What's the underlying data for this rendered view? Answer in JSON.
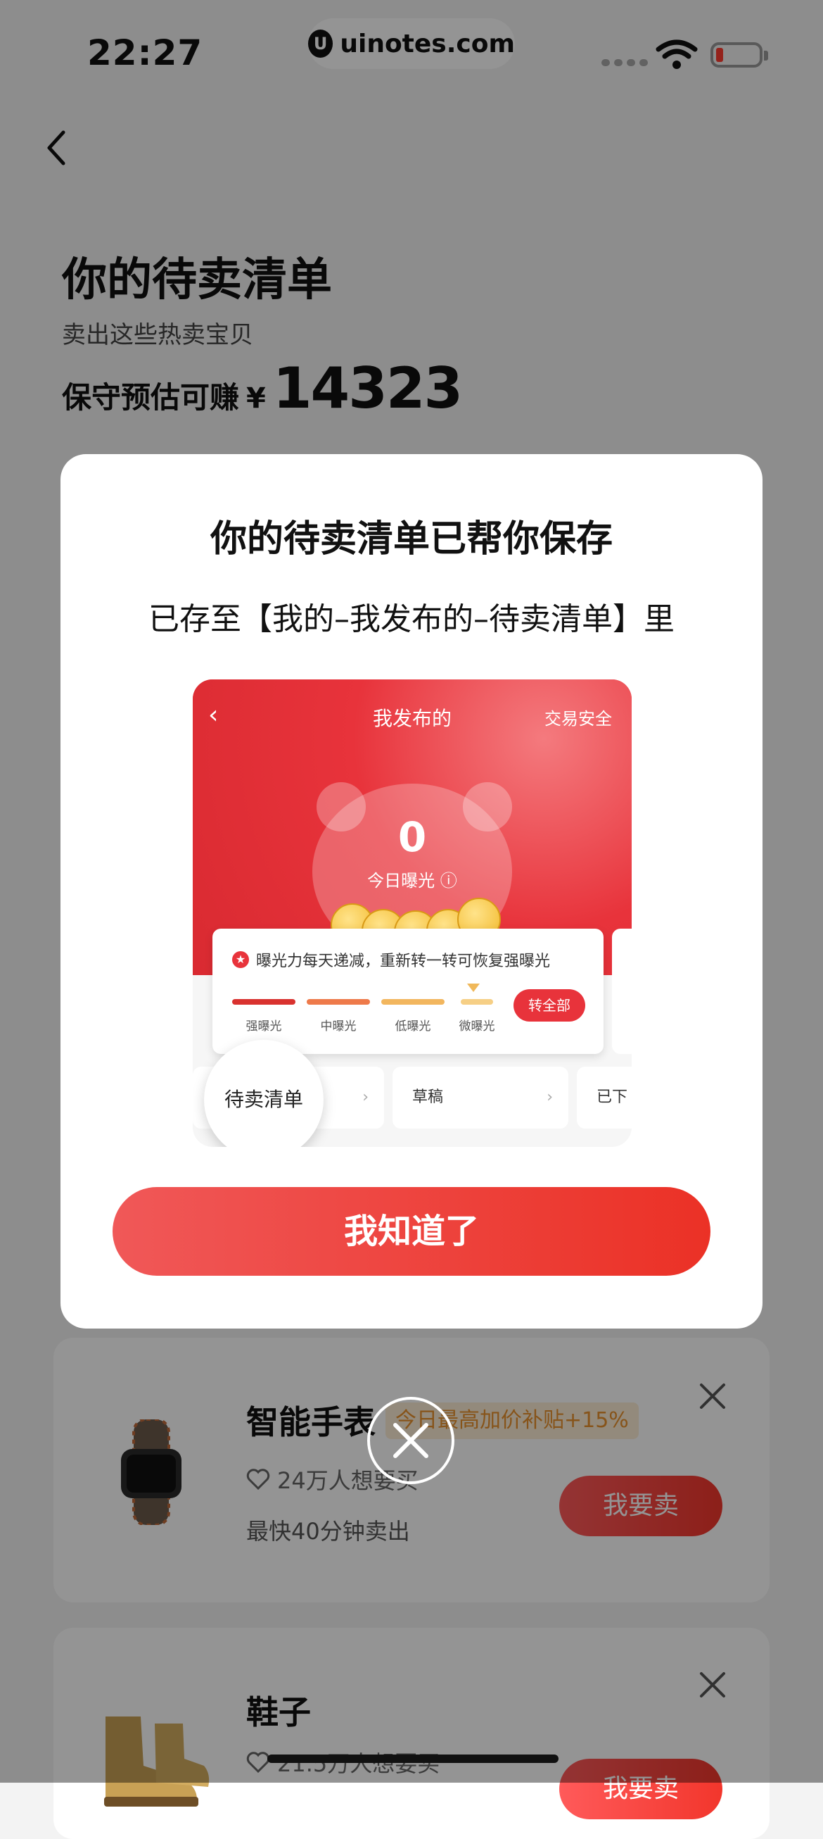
{
  "status": {
    "time": "22:27"
  },
  "watermark": {
    "text": "uinotes.com"
  },
  "page": {
    "title": "你的待卖清单",
    "subtitle": "卖出这些热卖宝贝",
    "earn_label": "保守预估可赚",
    "currency": "¥",
    "earn_amount": "14323"
  },
  "items": [
    {
      "name": "智能手表",
      "tag": "今日最高加价补贴+15%",
      "want": "24万人想要买",
      "speed": "最快40分钟卖出",
      "sell": "我要卖"
    },
    {
      "name": "鞋子",
      "want": "21.5万人想要买",
      "sell": "我要卖"
    }
  ],
  "modal": {
    "title": "你的待卖清单已帮你保存",
    "subtitle": "已存至【我的–我发布的–待卖清单】里",
    "confirm": "我知道了",
    "preview": {
      "back": "‹",
      "title": "我发布的",
      "safe": "交易安全",
      "count": "0",
      "count_label": "今日曝光 ⓘ",
      "tip": "曝光力每天递减，重新转一转可恢复强曝光",
      "levels": [
        "强曝光",
        "中曝光",
        "低曝光",
        "微曝光"
      ],
      "level_colors": [
        "#d9322f",
        "#ee7a4a",
        "#f2b65e",
        "#f6cf85"
      ],
      "transfer_all": "转全部",
      "tabs": [
        "待卖清单",
        "草稿",
        "已下架"
      ],
      "tab3_visible": "已下"
    }
  },
  "icons": {
    "back": "chevron-left-icon",
    "close": "close-icon",
    "heart": "heart-icon",
    "star": "star-icon"
  }
}
